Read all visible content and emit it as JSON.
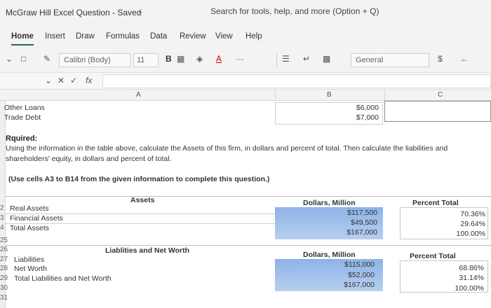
{
  "app": {
    "title": "McGraw Hill Excel Question - Saved",
    "search_placeholder": "Search for tools, help, and more (Option + Q)"
  },
  "tabs": [
    "Home",
    "Insert",
    "Draw",
    "Formulas",
    "Data",
    "Review",
    "View",
    "Help"
  ],
  "toolbar": {
    "font": "Calibri (Body)",
    "size": "11",
    "bold": "B",
    "underline_a": "A",
    "more": "···",
    "number_format": "General",
    "currency": "$"
  },
  "formula_bar": {
    "fx": "fx"
  },
  "columns": [
    "A",
    "B",
    "C"
  ],
  "cells": {
    "other_loans_label": "Other Loans",
    "other_loans_value": "$6,000",
    "trade_debt_label": "Trade Debt",
    "trade_debt_value": "$7,000",
    "required_title": "Rquired:",
    "required_text": "Using the information in the table above, calculate the Assets of this firm, in dollars and percent of total. Then calculate the liabilities and shareholders' equity, in dollars and percent of total.",
    "required_note": "(Use cells A3 to B14 from the given information to complete this question.)",
    "assets_header": "Assets",
    "dollars_header_1": "Dollars, Million",
    "percent_header_1": "Percent Total",
    "real_assets_label": "Real Assets",
    "real_assets_value": "$117,500",
    "real_assets_pct": "70.36%",
    "financial_assets_label": "Financial Assets",
    "financial_assets_value": "$49,500",
    "financial_assets_pct": "29.64%",
    "total_assets_label": "Total Assets",
    "total_assets_value": "$167,000",
    "total_assets_pct": "100.00%",
    "liab_header": "Liablities and Net Worth",
    "dollars_header_2": "Dollars, Million",
    "percent_header_2": "Percent Total",
    "liabilities_label": "Liabilities",
    "liabilities_value": "$115,000",
    "liabilities_pct": "68.86%",
    "net_worth_label": "Net Worth",
    "net_worth_value": "$52,000",
    "net_worth_pct": "31.14%",
    "total_liab_label": "Total Liabilities and Net Worth",
    "total_liab_value": "$167,000",
    "total_liab_pct": "100.00%"
  },
  "row_numbers": {
    "r22": "2",
    "r23": "3",
    "r24": "4",
    "r25": "25",
    "r26": "26",
    "r27": "27",
    "r28": "28",
    "r29": "29",
    "r30": "30",
    "r31": "31"
  }
}
